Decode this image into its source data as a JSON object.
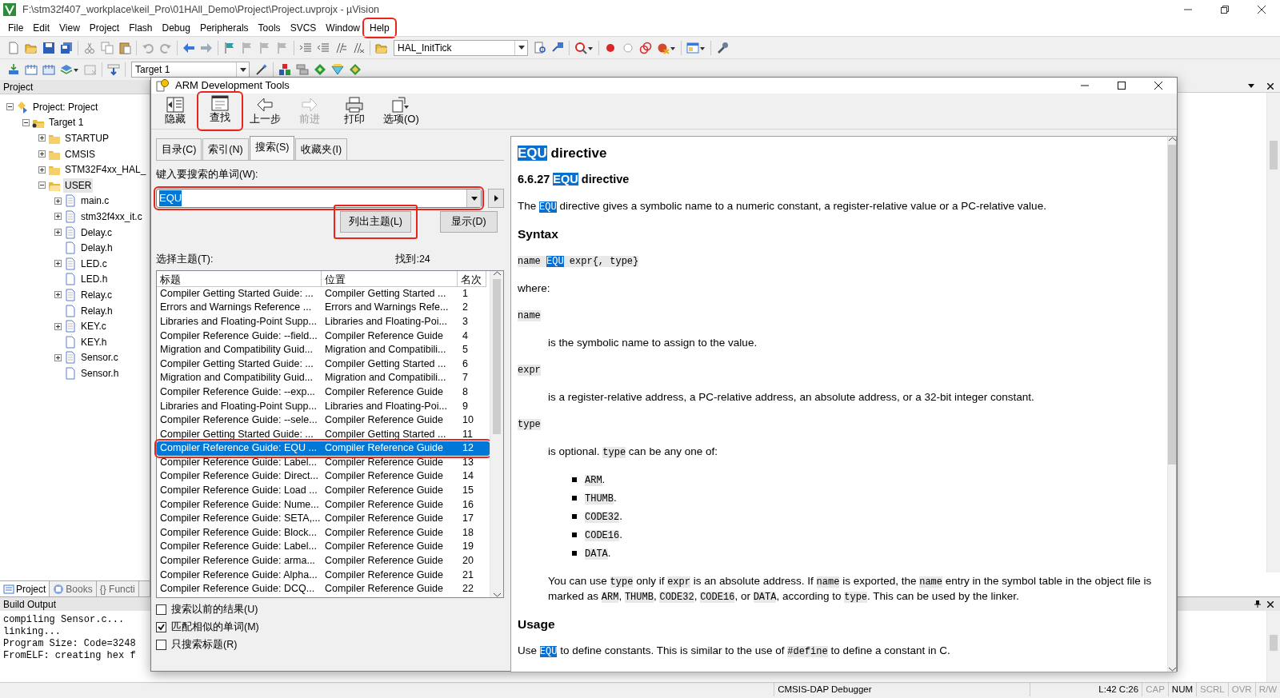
{
  "window": {
    "title": "F:\\stm32f407_workplace\\keil_Pro\\01HAll_Demo\\Project\\Project.uvprojx - µVision"
  },
  "menu": [
    {
      "label": "File",
      "highlighted": false
    },
    {
      "label": "Edit",
      "highlighted": false
    },
    {
      "label": "View",
      "highlighted": false
    },
    {
      "label": "Project",
      "highlighted": false
    },
    {
      "label": "Flash",
      "highlighted": false
    },
    {
      "label": "Debug",
      "highlighted": false
    },
    {
      "label": "Peripherals",
      "highlighted": false
    },
    {
      "label": "Tools",
      "highlighted": false
    },
    {
      "label": "SVCS",
      "highlighted": false
    },
    {
      "label": "Window",
      "highlighted": false
    },
    {
      "label": "Help",
      "highlighted": true
    }
  ],
  "toolbar": {
    "function_combo": "HAL_InitTick",
    "target_combo": "Target 1"
  },
  "project_panel": {
    "title": "Project",
    "tree": [
      {
        "label": "Project: Project",
        "kind": "project",
        "expanded": true,
        "selected": false,
        "children": [
          {
            "label": "Target 1",
            "kind": "target",
            "expanded": true,
            "selected": false,
            "children": [
              {
                "label": "STARTUP",
                "kind": "folder",
                "expanded": false,
                "selected": false
              },
              {
                "label": "CMSIS",
                "kind": "folder",
                "expanded": false,
                "selected": false
              },
              {
                "label": "STM32F4xx_HAL_",
                "kind": "folder",
                "expanded": false,
                "selected": false
              },
              {
                "label": "USER",
                "kind": "folder",
                "expanded": true,
                "selected": true,
                "children": [
                  {
                    "label": "main.c",
                    "kind": "source",
                    "expanded": false,
                    "selected": false
                  },
                  {
                    "label": "stm32f4xx_it.c",
                    "kind": "source",
                    "expanded": false,
                    "selected": false
                  },
                  {
                    "label": "Delay.c",
                    "kind": "source",
                    "expanded": false,
                    "selected": false
                  },
                  {
                    "label": "Delay.h",
                    "kind": "header",
                    "selected": false
                  },
                  {
                    "label": "LED.c",
                    "kind": "source",
                    "expanded": false,
                    "selected": false
                  },
                  {
                    "label": "LED.h",
                    "kind": "header",
                    "selected": false
                  },
                  {
                    "label": "Relay.c",
                    "kind": "source",
                    "expanded": false,
                    "selected": false
                  },
                  {
                    "label": "Relay.h",
                    "kind": "header",
                    "selected": false
                  },
                  {
                    "label": "KEY.c",
                    "kind": "source",
                    "expanded": false,
                    "selected": false
                  },
                  {
                    "label": "KEY.h",
                    "kind": "header",
                    "selected": false
                  },
                  {
                    "label": "Sensor.c",
                    "kind": "source",
                    "expanded": false,
                    "selected": false
                  },
                  {
                    "label": "Sensor.h",
                    "kind": "header",
                    "selected": false
                  }
                ]
              }
            ]
          }
        ]
      }
    ],
    "tabs": [
      {
        "label": "Project",
        "kind": "project",
        "selected": true
      },
      {
        "label": "Books",
        "kind": "books",
        "selected": false
      },
      {
        "label": "{} Functi",
        "kind": "functions",
        "selected": false
      }
    ]
  },
  "build_output": {
    "title": "Build Output",
    "lines": [
      "compiling Sensor.c...",
      "linking...",
      "Program Size: Code=3248",
      "FromELF: creating hex f"
    ]
  },
  "help_dialog": {
    "title": "ARM Development Tools",
    "toolbar": [
      {
        "label": "隐藏",
        "kind": "hide",
        "highlighted": false,
        "disabled": false
      },
      {
        "label": "查找",
        "kind": "find",
        "highlighted": true,
        "disabled": false
      },
      {
        "label": "上一步",
        "kind": "back",
        "highlighted": false,
        "disabled": false
      },
      {
        "label": "前进",
        "kind": "forward",
        "highlighted": false,
        "disabled": true
      },
      {
        "label": "打印",
        "kind": "print",
        "highlighted": false,
        "disabled": false
      },
      {
        "label": "选项(O)",
        "kind": "options",
        "highlighted": false,
        "disabled": false
      }
    ],
    "tabs": [
      {
        "label": "目录(C)",
        "selected": false
      },
      {
        "label": "索引(N)",
        "selected": false
      },
      {
        "label": "搜索(S)",
        "selected": true
      },
      {
        "label": "收藏夹(I)",
        "selected": false
      }
    ],
    "search": {
      "label": "键入要搜索的单词(W):",
      "value": "EQU",
      "text_selected": true,
      "highlighted": true
    },
    "buttons": [
      {
        "label": "列出主题(L)",
        "highlighted": true
      },
      {
        "label": "显示(D)",
        "highlighted": false
      }
    ],
    "topics_label": "选择主题(T):",
    "found": "找到:24",
    "columns": [
      "标题",
      "位置",
      "名次"
    ],
    "rows": [
      {
        "title": "Compiler Getting Started Guide: ...",
        "location": "Compiler Getting Started ...",
        "rank": "1",
        "selected": false,
        "highlighted": false
      },
      {
        "title": "Errors and Warnings Reference ...",
        "location": "Errors and Warnings Refe...",
        "rank": "2",
        "selected": false,
        "highlighted": false
      },
      {
        "title": "Libraries and Floating-Point Supp...",
        "location": "Libraries and Floating-Poi...",
        "rank": "3",
        "selected": false,
        "highlighted": false
      },
      {
        "title": "Compiler Reference Guide: --field...",
        "location": "Compiler Reference Guide",
        "rank": "4",
        "selected": false,
        "highlighted": false
      },
      {
        "title": "Migration and Compatibility Guid...",
        "location": "Migration and Compatibili...",
        "rank": "5",
        "selected": false,
        "highlighted": false
      },
      {
        "title": "Compiler Getting Started Guide: ...",
        "location": "Compiler Getting Started ...",
        "rank": "6",
        "selected": false,
        "highlighted": false
      },
      {
        "title": "Migration and Compatibility Guid...",
        "location": "Migration and Compatibili...",
        "rank": "7",
        "selected": false,
        "highlighted": false
      },
      {
        "title": "Compiler Reference Guide: --exp...",
        "location": "Compiler Reference Guide",
        "rank": "8",
        "selected": false,
        "highlighted": false
      },
      {
        "title": "Libraries and Floating-Point Supp...",
        "location": "Libraries and Floating-Poi...",
        "rank": "9",
        "selected": false,
        "highlighted": false
      },
      {
        "title": "Compiler Reference Guide: --sele...",
        "location": "Compiler Reference Guide",
        "rank": "10",
        "selected": false,
        "highlighted": false
      },
      {
        "title": "Compiler Getting Started Guide: ...",
        "location": "Compiler Getting Started ...",
        "rank": "11",
        "selected": false,
        "highlighted": false
      },
      {
        "title": "Compiler Reference Guide: EQU ...",
        "location": "Compiler Reference Guide",
        "rank": "12",
        "selected": true,
        "highlighted": true
      },
      {
        "title": "Compiler Reference Guide: Label...",
        "location": "Compiler Reference Guide",
        "rank": "13",
        "selected": false,
        "highlighted": false
      },
      {
        "title": "Compiler Reference Guide: Direct...",
        "location": "Compiler Reference Guide",
        "rank": "14",
        "selected": false,
        "highlighted": false
      },
      {
        "title": "Compiler Reference Guide: Load ...",
        "location": "Compiler Reference Guide",
        "rank": "15",
        "selected": false,
        "highlighted": false
      },
      {
        "title": "Compiler Reference Guide: Nume...",
        "location": "Compiler Reference Guide",
        "rank": "16",
        "selected": false,
        "highlighted": false
      },
      {
        "title": "Compiler Reference Guide: SETA,...",
        "location": "Compiler Reference Guide",
        "rank": "17",
        "selected": false,
        "highlighted": false
      },
      {
        "title": "Compiler Reference Guide: Block...",
        "location": "Compiler Reference Guide",
        "rank": "18",
        "selected": false,
        "highlighted": false
      },
      {
        "title": "Compiler Reference Guide: Label...",
        "location": "Compiler Reference Guide",
        "rank": "19",
        "selected": false,
        "highlighted": false
      },
      {
        "title": "Compiler Reference Guide: arma...",
        "location": "Compiler Reference Guide",
        "rank": "20",
        "selected": false,
        "highlighted": false
      },
      {
        "title": "Compiler Reference Guide: Alpha...",
        "location": "Compiler Reference Guide",
        "rank": "21",
        "selected": false,
        "highlighted": false
      },
      {
        "title": "Compiler Reference Guide: DCQ...",
        "location": "Compiler Reference Guide",
        "rank": "22",
        "selected": false,
        "highlighted": false
      }
    ],
    "options": [
      {
        "label": "搜索以前的结果(U)",
        "checked": false
      },
      {
        "label": "匹配相似的单词(M)",
        "checked": true
      },
      {
        "label": "只搜索标题(R)",
        "checked": false
      }
    ],
    "content": [
      {
        "kind": "h1",
        "segments": [
          {
            "kind": "hit",
            "text": "EQU"
          },
          {
            "kind": "text",
            "text": " directive"
          }
        ]
      },
      {
        "kind": "h2",
        "segments": [
          {
            "kind": "text",
            "text": "6.6.27 "
          },
          {
            "kind": "hit",
            "text": "EQU"
          },
          {
            "kind": "text",
            "text": " directive"
          }
        ]
      },
      {
        "kind": "p",
        "segments": [
          {
            "kind": "text",
            "text": "The "
          },
          {
            "kind": "hitcode",
            "text": "EQU"
          },
          {
            "kind": "text",
            "text": " directive gives a symbolic name to a numeric constant, a register-relative value or a PC-relative value."
          }
        ]
      },
      {
        "kind": "h3",
        "segments": [
          {
            "kind": "text",
            "text": "Syntax"
          }
        ]
      },
      {
        "kind": "code",
        "segments": [
          {
            "kind": "code",
            "text": "name "
          },
          {
            "kind": "hitcode",
            "text": "EQU"
          },
          {
            "kind": "code",
            "text": " expr{, type}"
          }
        ]
      },
      {
        "kind": "p",
        "segments": [
          {
            "kind": "text",
            "text": "where:"
          }
        ]
      },
      {
        "kind": "term",
        "segments": [
          {
            "kind": "code",
            "text": "name"
          }
        ]
      },
      {
        "kind": "dd",
        "segments": [
          {
            "kind": "text",
            "text": "is the symbolic name to assign to the value."
          }
        ]
      },
      {
        "kind": "term",
        "segments": [
          {
            "kind": "code",
            "text": "expr"
          }
        ]
      },
      {
        "kind": "dd",
        "segments": [
          {
            "kind": "text",
            "text": "is a register-relative address, a PC-relative address, an absolute address, or a 32-bit integer constant."
          }
        ]
      },
      {
        "kind": "term",
        "segments": [
          {
            "kind": "code",
            "text": "type"
          }
        ]
      },
      {
        "kind": "dd",
        "segments": [
          {
            "kind": "text",
            "text": "is optional. "
          },
          {
            "kind": "code",
            "text": "type"
          },
          {
            "kind": "text",
            "text": " can be any one of:"
          }
        ]
      },
      {
        "kind": "list",
        "items": [
          [
            {
              "kind": "code",
              "text": "ARM"
            },
            {
              "kind": "text",
              "text": "."
            }
          ],
          [
            {
              "kind": "code",
              "text": "THUMB"
            },
            {
              "kind": "text",
              "text": "."
            }
          ],
          [
            {
              "kind": "code",
              "text": "CODE32"
            },
            {
              "kind": "text",
              "text": "."
            }
          ],
          [
            {
              "kind": "code",
              "text": "CODE16"
            },
            {
              "kind": "text",
              "text": "."
            }
          ],
          [
            {
              "kind": "code",
              "text": "DATA"
            },
            {
              "kind": "text",
              "text": "."
            }
          ]
        ]
      },
      {
        "kind": "dd",
        "segments": [
          {
            "kind": "text",
            "text": "You can use "
          },
          {
            "kind": "code",
            "text": "type"
          },
          {
            "kind": "text",
            "text": " only if "
          },
          {
            "kind": "code",
            "text": "expr"
          },
          {
            "kind": "text",
            "text": " is an absolute address. If "
          },
          {
            "kind": "code",
            "text": "name"
          },
          {
            "kind": "text",
            "text": " is exported, the "
          },
          {
            "kind": "code",
            "text": "name"
          },
          {
            "kind": "text",
            "text": " entry in the symbol table in the object file is marked as "
          },
          {
            "kind": "code",
            "text": "ARM"
          },
          {
            "kind": "text",
            "text": ", "
          },
          {
            "kind": "code",
            "text": "THUMB"
          },
          {
            "kind": "text",
            "text": ", "
          },
          {
            "kind": "code",
            "text": "CODE32"
          },
          {
            "kind": "text",
            "text": ", "
          },
          {
            "kind": "code",
            "text": "CODE16"
          },
          {
            "kind": "text",
            "text": ", or "
          },
          {
            "kind": "code",
            "text": "DATA"
          },
          {
            "kind": "text",
            "text": ", according to "
          },
          {
            "kind": "code",
            "text": "type"
          },
          {
            "kind": "text",
            "text": ". This can be used by the linker."
          }
        ]
      },
      {
        "kind": "h3",
        "segments": [
          {
            "kind": "text",
            "text": "Usage"
          }
        ]
      },
      {
        "kind": "p",
        "segments": [
          {
            "kind": "text",
            "text": "Use "
          },
          {
            "kind": "hitcode",
            "text": "EQU"
          },
          {
            "kind": "text",
            "text": " to define constants. This is similar to the use of "
          },
          {
            "kind": "code",
            "text": "#define"
          },
          {
            "kind": "text",
            "text": " to define a constant in C."
          }
        ]
      }
    ]
  },
  "status_bar": {
    "debugger": "CMSIS-DAP Debugger",
    "position": "L:42 C:26",
    "indicators": [
      {
        "label": "CAP",
        "on": false
      },
      {
        "label": "NUM",
        "on": true
      },
      {
        "label": "SCRL",
        "on": false
      },
      {
        "label": "OVR",
        "on": false
      },
      {
        "label": "R/W",
        "on": false
      }
    ]
  }
}
